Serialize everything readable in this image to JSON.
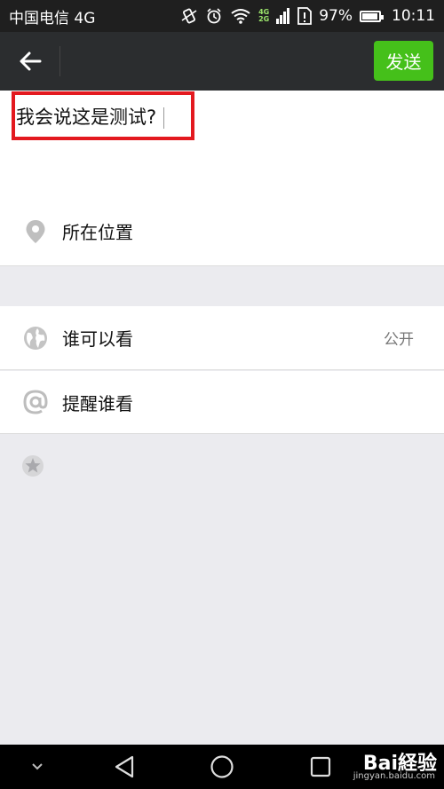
{
  "status_bar": {
    "carrier": "中国电信 4G",
    "network_4g": "4G",
    "network_2g": "2G",
    "battery": "97%",
    "battery_level": 0.97,
    "time": "10:11"
  },
  "nav": {
    "send_label": "发送"
  },
  "compose": {
    "text": "我会说这是测试?"
  },
  "location": {
    "label": "所在位置",
    "icon": "location-pin-icon"
  },
  "visibility": {
    "label": "谁可以看",
    "value": "公开",
    "icon": "globe-icon"
  },
  "remind": {
    "label": "提醒谁看",
    "icon": "at-icon"
  },
  "watermark": {
    "brand": "Bai経验",
    "url": "jingyan.baidu.com"
  },
  "colors": {
    "send_button": "#45c01a",
    "highlight": "#e3191f",
    "nav_bg": "#2b2d2f"
  }
}
